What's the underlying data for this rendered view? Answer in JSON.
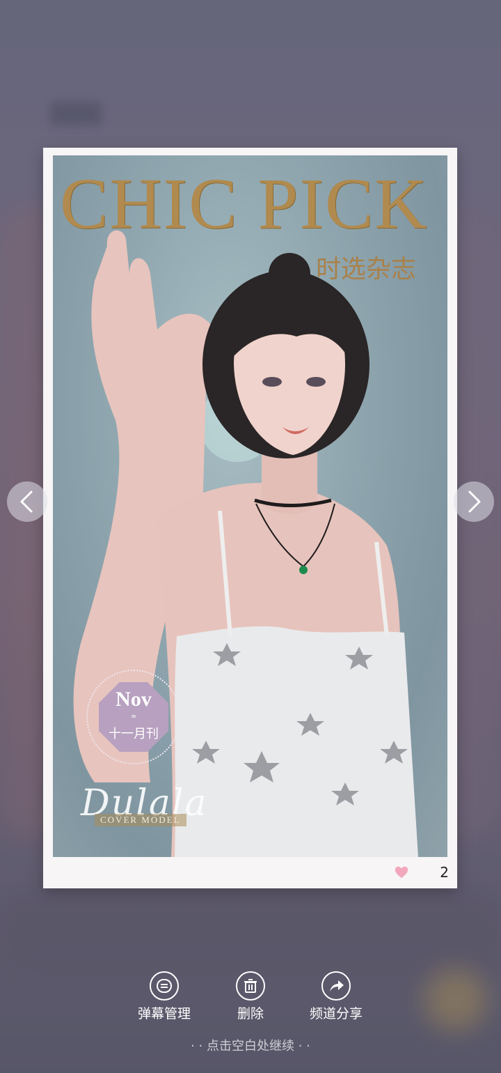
{
  "background": {
    "blurred_title": ""
  },
  "magazine": {
    "title": "CHIC PICK",
    "subtitle": "时选杂志",
    "issue_month": "Nov",
    "issue_cn": "十一月刊",
    "signature": "Dulala",
    "cover_label": "COVER MODEL"
  },
  "likes": {
    "count": "2",
    "heart_color": "#f2a7bd"
  },
  "actions": {
    "danmaku_label": "弹幕管理",
    "delete_label": "删除",
    "share_label": "频道分享"
  },
  "hint": "· · 点击空白处继续 · ·",
  "icons": {
    "prev": "chevron-left-icon",
    "next": "chevron-right-icon",
    "danmaku": "danmaku-icon",
    "delete": "trash-icon",
    "share": "share-arrow-icon",
    "like": "heart-icon"
  }
}
